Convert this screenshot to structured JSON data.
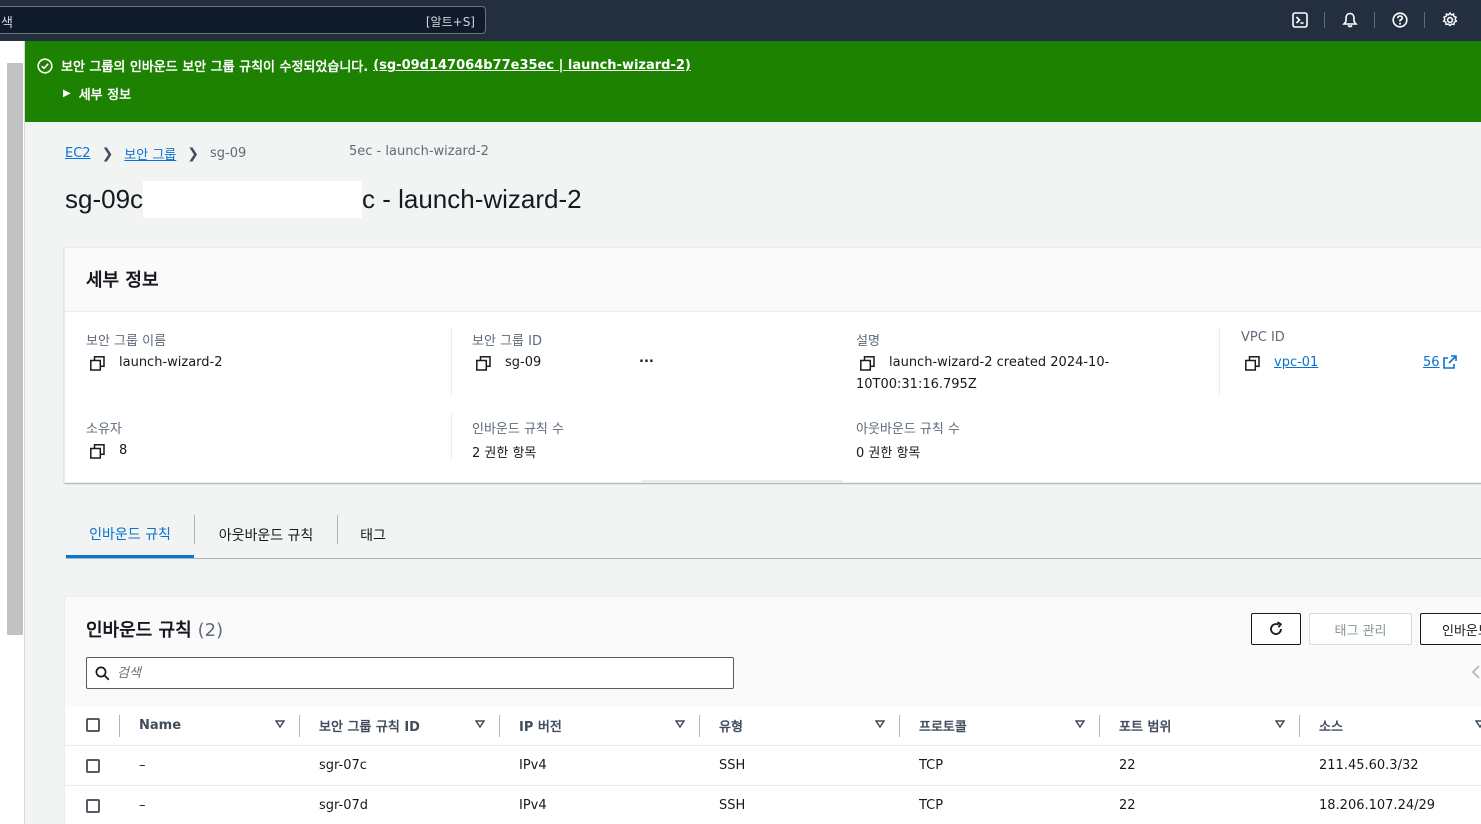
{
  "topnav": {
    "search_placeholder": "색",
    "search_shortcut": "[알트+S]",
    "icons": [
      "cloudshell-icon",
      "bell-icon",
      "help-icon",
      "settings-icon"
    ]
  },
  "flash": {
    "message": "보안 그룹의 인바운드 보안 그룹 규칙이 수정되었습니다.",
    "link": "(sg-09d147064b77e35ec | launch-wizard-2)",
    "details_toggle": "세부 정보",
    "color": "#1d8102"
  },
  "breadcrumb": {
    "items": [
      "EC2",
      "보안 그룹"
    ],
    "current_part1": "sg-09",
    "current_part2": "5ec - launch-wizard-2"
  },
  "page_title": {
    "prefix": "sg-09c",
    "suffix": "c - launch-wizard-2"
  },
  "details": {
    "title": "세부 정보",
    "fields": {
      "sg_name": {
        "label": "보안 그룹 이름",
        "value": "launch-wizard-2"
      },
      "sg_id": {
        "label": "보안 그룹 ID",
        "value": "sg-09",
        "tail": "..."
      },
      "description": {
        "label": "설명",
        "value_line1": "launch-wizard-2 created 2024-10-",
        "value_line2": "10T00:31:16.795Z"
      },
      "vpc_id": {
        "label": "VPC ID",
        "value": "vpc-01",
        "tail": "56"
      },
      "owner": {
        "label": "소유자",
        "value": "8"
      },
      "inbound_count": {
        "label": "인바운드 규칙 수",
        "value": "2 권한 항목"
      },
      "outbound_count": {
        "label": "아웃바운드 규칙 수",
        "value": "0 권한 항목"
      }
    }
  },
  "tabs": [
    {
      "label": "인바운드 규칙",
      "active": true
    },
    {
      "label": "아웃바운드 규칙",
      "active": false
    },
    {
      "label": "태그",
      "active": false
    }
  ],
  "inbound_table": {
    "title": "인바운드 규칙",
    "count": "(2)",
    "buttons": {
      "manage_tags": "태그 관리",
      "edit_inbound": "인바운드"
    },
    "search_placeholder": "검색",
    "columns": [
      "Name",
      "보안 그룹 규칙 ID",
      "IP 버전",
      "유형",
      "프로토콜",
      "포트 범위",
      "소스"
    ],
    "rows": [
      {
        "name": "–",
        "rule_id": "sgr-07c",
        "ip": "IPv4",
        "type": "SSH",
        "protocol": "TCP",
        "port": "22",
        "source": "211.45.60.3/32"
      },
      {
        "name": "–",
        "rule_id": "sgr-07d",
        "ip": "IPv4",
        "type": "SSH",
        "protocol": "TCP",
        "port": "22",
        "source": "18.206.107.24/29"
      }
    ]
  },
  "colors": {
    "link": "#0972d3",
    "nav_bg": "#232f3e",
    "success": "#1d8102"
  }
}
